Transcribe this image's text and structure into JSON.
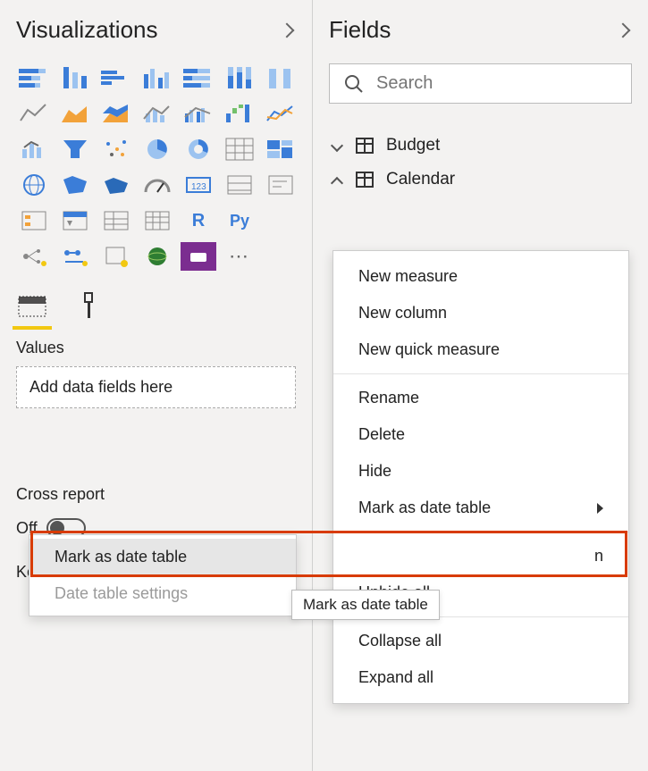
{
  "visualizations": {
    "title": "Visualizations",
    "icons": [
      "stacked-bar-chart",
      "clustered-bar-chart",
      "stacked-column-chart",
      "clustered-column-chart",
      "100-stacked-bar-chart",
      "100-stacked-column-chart",
      "ribbon-chart",
      "line-chart",
      "area-chart",
      "stacked-area-chart",
      "line-stacked-column-chart",
      "line-clustered-column-chart",
      "waterfall-chart",
      "scatter-chart-2",
      "funnel-chart",
      "scatter-chart",
      "bubble-chart",
      "pie-chart",
      "donut-chart",
      "treemap",
      "map",
      "filled-map",
      "shape-map",
      "arcgis-map",
      "gauge",
      "card",
      "multi-row-card",
      "kpi",
      "slicer",
      "table",
      "matrix",
      "r-script-visual",
      "python-visual",
      "key-influencers",
      "decomposition-tree",
      "qna-visual",
      "smart-narrative",
      "paginated-report",
      "power-apps",
      "power-automate",
      "import-visual",
      "more-visuals"
    ],
    "r_label": "R",
    "py_label": "Py",
    "more_label": "⋯",
    "well_tabs": {
      "fields": "Fields",
      "format": "Format"
    },
    "values_label": "Values",
    "drop_placeholder": "Add data fields here",
    "cross_report_label": "Cross report",
    "off_label": "Off",
    "keep_filters_label": "Keep all filters"
  },
  "fields": {
    "title": "Fields",
    "search_placeholder": "Search",
    "tables": [
      {
        "name": "Budget",
        "expanded": false
      },
      {
        "name": "Calendar",
        "expanded": true
      }
    ]
  },
  "context_menu": {
    "new_measure": "New measure",
    "new_column": "New column",
    "new_quick_measure": "New quick measure",
    "rename": "Rename",
    "delete": "Delete",
    "hide": "Hide",
    "mark_as_date_table": "Mark as date table",
    "partial_item": "n",
    "unhide_all": "Unhide all",
    "collapse_all": "Collapse all",
    "expand_all": "Expand all"
  },
  "submenu": {
    "mark_as_date_table": "Mark as date table",
    "date_table_settings": "Date table settings"
  },
  "tooltip": {
    "text": "Mark as date table"
  }
}
